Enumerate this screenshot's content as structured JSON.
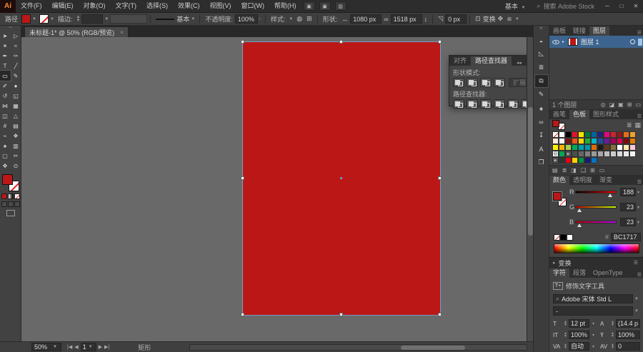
{
  "window": {
    "app_logo": "Ai",
    "menus": [
      "文件(F)",
      "编辑(E)",
      "对象(O)",
      "文字(T)",
      "选择(S)",
      "效果(C)",
      "视图(V)",
      "窗口(W)",
      "帮助(H)"
    ],
    "workspace_label": "基本",
    "search_placeholder": "搜索 Adobe Stock",
    "minimize": "─",
    "maximize": "□",
    "close": "✕"
  },
  "options_bar": {
    "selection_label": "路径",
    "stroke_label": "描边:",
    "brush_definition": "基本",
    "opacity_label": "不透明度:",
    "opacity_value": "100%",
    "style_label": "样式:",
    "shape_label": "形状:",
    "shape_width": "1080 px",
    "shape_height": "1518 px",
    "corner_value": "0 px",
    "transform_label": "变换",
    "fill_color": "#bc1717"
  },
  "document_tab": {
    "title": "未标题-1* @ 50% (RGB/预览)",
    "close": "×"
  },
  "tools": {
    "items": [
      {
        "name": "selection-tool",
        "glyph": "➤",
        "selected": false
      },
      {
        "name": "direct-selection-tool",
        "glyph": "▷",
        "selected": false
      },
      {
        "name": "magic-wand-tool",
        "glyph": "✶",
        "selected": false
      },
      {
        "name": "lasso-tool",
        "glyph": "≈",
        "selected": false
      },
      {
        "name": "pen-tool",
        "glyph": "✒",
        "selected": false
      },
      {
        "name": "curvature-tool",
        "glyph": "✑",
        "selected": false
      },
      {
        "name": "type-tool",
        "glyph": "T",
        "selected": false
      },
      {
        "name": "line-segment-tool",
        "glyph": "╱",
        "selected": false
      },
      {
        "name": "rectangle-tool",
        "glyph": "▭",
        "selected": true
      },
      {
        "name": "paintbrush-tool",
        "glyph": "✎",
        "selected": false
      },
      {
        "name": "pencil-tool",
        "glyph": "✐",
        "selected": false
      },
      {
        "name": "blob-brush-tool",
        "glyph": "●",
        "selected": false
      },
      {
        "name": "rotate-tool",
        "glyph": "↺",
        "selected": false
      },
      {
        "name": "scale-tool",
        "glyph": "◱",
        "selected": false
      },
      {
        "name": "width-tool",
        "glyph": "⋈",
        "selected": false
      },
      {
        "name": "free-transform-tool",
        "glyph": "▦",
        "selected": false
      },
      {
        "name": "shape-builder-tool",
        "glyph": "◫",
        "selected": false
      },
      {
        "name": "perspective-grid-tool",
        "glyph": "△",
        "selected": false
      },
      {
        "name": "mesh-tool",
        "glyph": "#",
        "selected": false
      },
      {
        "name": "gradient-tool",
        "glyph": "▤",
        "selected": false
      },
      {
        "name": "eyedropper-tool",
        "glyph": "⌁",
        "selected": false
      },
      {
        "name": "blend-tool",
        "glyph": "❖",
        "selected": false
      },
      {
        "name": "symbol-sprayer-tool",
        "glyph": "♠",
        "selected": false
      },
      {
        "name": "column-graph-tool",
        "glyph": "▥",
        "selected": false
      },
      {
        "name": "artboard-tool",
        "glyph": "▢",
        "selected": false
      },
      {
        "name": "slice-tool",
        "glyph": "✂",
        "selected": false
      },
      {
        "name": "hand-tool",
        "glyph": "✥",
        "selected": false
      },
      {
        "name": "zoom-tool",
        "glyph": "⊙",
        "selected": false
      }
    ]
  },
  "canvas": {
    "rect_fill": "#bc1717"
  },
  "pathfinder_panel": {
    "tabs": [
      "对齐",
      "路径查找器"
    ],
    "shape_modes_label": "形状模式:",
    "expand_label": "扩展",
    "pathfinders_label": "路径查找器:",
    "shape_mode_buttons": [
      "unite",
      "minus-front",
      "intersect",
      "exclude"
    ],
    "pathfinder_buttons": [
      "divide",
      "trim",
      "merge",
      "crop",
      "outline",
      "minus-back"
    ]
  },
  "dock": {
    "strip_icons": [
      {
        "name": "color-panel-icon",
        "glyph": "◒",
        "active": false
      },
      {
        "name": "color-guide-icon",
        "glyph": "◺",
        "active": false
      },
      {
        "name": "stroke-panel-icon",
        "glyph": "≣",
        "active": false
      },
      {
        "name": "pathfinder-panel-icon",
        "glyph": "⧉",
        "active": true
      },
      {
        "name": "brushes-panel-icon",
        "glyph": "✎",
        "active": false
      },
      {
        "name": "symbols-panel-icon",
        "glyph": "♠",
        "active": false
      },
      {
        "name": "links-panel-icon",
        "glyph": "∞",
        "active": false
      },
      {
        "name": "asset-export-icon",
        "glyph": "↧",
        "active": false
      },
      {
        "name": "glyphs-panel-icon",
        "glyph": "A",
        "active": false
      },
      {
        "name": "libraries-panel-icon",
        "glyph": "❐",
        "active": false
      }
    ],
    "layers_group": {
      "tabs": [
        "画板",
        "链接",
        "图层"
      ],
      "layer_name": "图层 1",
      "footer_count": "1 个图层",
      "footer_icons": [
        "locate-object-icon",
        "make-mask-icon",
        "new-sublayer-icon",
        "new-layer-icon",
        "delete-layer-icon"
      ],
      "footer_glyphs": [
        "◎",
        "◪",
        "▣",
        "⊞",
        "▭"
      ]
    },
    "swatches_group": {
      "tabs": [
        "画笔",
        "色板",
        "图形样式"
      ],
      "rows": [
        [
          "none",
          "#ffffff",
          "#000000",
          "#e8112d",
          "#f9e300",
          "#007a3d",
          "#0063a3",
          "#232379",
          "#e5067e",
          "#cf2030",
          "#8f1a1e",
          "#e86c19",
          "#f0a22e"
        ],
        [
          "#fde9d9",
          "#ffffff",
          "#7f1416",
          "#ea5514",
          "#ffd400",
          "#22ac38",
          "#00b7ce",
          "#1d50a2",
          "#6a1b9a",
          "#a4005a",
          "#d7004a",
          "#7a0c0c",
          "#e07b00"
        ],
        [
          "#fff100",
          "#f8b500",
          "#a6d34e",
          "#00a95f",
          "#00a0a9",
          "#0097b2",
          "#e06a00",
          "#1a1a1a",
          "#5c3a1e",
          "#8a6d3b",
          "#ffffff",
          "#ffe9a8",
          "#f7c7d9"
        ],
        [
          "reg",
          "#00a651",
          "folder",
          "#4d4d4d",
          "#666666",
          "#808080",
          "#999999",
          "#a6a6a6",
          "#bfbfbf",
          "#cccccc",
          "#d9d9d9",
          "#e8e8e8",
          "#f5f5f5"
        ],
        [
          "folder",
          "#333333",
          "#e60012",
          "#ffd400",
          "#00913a",
          "#1b1878",
          "#0075c2",
          "",
          "",
          "",
          "",
          "",
          ""
        ]
      ],
      "footer_icons": [
        "swatch-libraries-icon",
        "swatch-kinds-icon",
        "swatch-options-icon",
        "new-color-group-icon",
        "new-swatch-icon",
        "delete-swatch-icon"
      ],
      "footer_glyphs": [
        "▤",
        "≣",
        "◨",
        "❏",
        "⊞",
        "▭"
      ]
    },
    "color_group": {
      "tabs": [
        "颜色",
        "透明度",
        "渐变"
      ],
      "sliders": [
        {
          "label": "R",
          "value": "188",
          "pos": 0.85
        },
        {
          "label": "G",
          "value": "23",
          "pos": 0.09
        },
        {
          "label": "B",
          "value": "23",
          "pos": 0.09
        }
      ],
      "hex_label": "#",
      "hex_value": "BC1717"
    },
    "transform_header": "变换",
    "character_group": {
      "tabs": [
        "字符",
        "段落",
        "OpenType"
      ],
      "touch_type_label": "修饰文字工具",
      "font_name": "Adobe 宋体 Std L",
      "font_style": "-",
      "fields": [
        {
          "name": "font-size-field",
          "icon": "T",
          "value": "12 pt"
        },
        {
          "name": "leading-field",
          "icon": "A",
          "value": "(14.4 p"
        },
        {
          "name": "vertical-scale-field",
          "icon": "IT",
          "value": "100%"
        },
        {
          "name": "horizontal-scale-field",
          "icon": "Ŧ",
          "value": "100%"
        },
        {
          "name": "kerning-field",
          "icon": "VA",
          "value": "自动"
        },
        {
          "name": "tracking-field",
          "icon": "AV",
          "value": "0"
        }
      ]
    }
  },
  "status_bar": {
    "zoom_value": "50%",
    "artboard_number": "1",
    "status_text": "矩形"
  }
}
